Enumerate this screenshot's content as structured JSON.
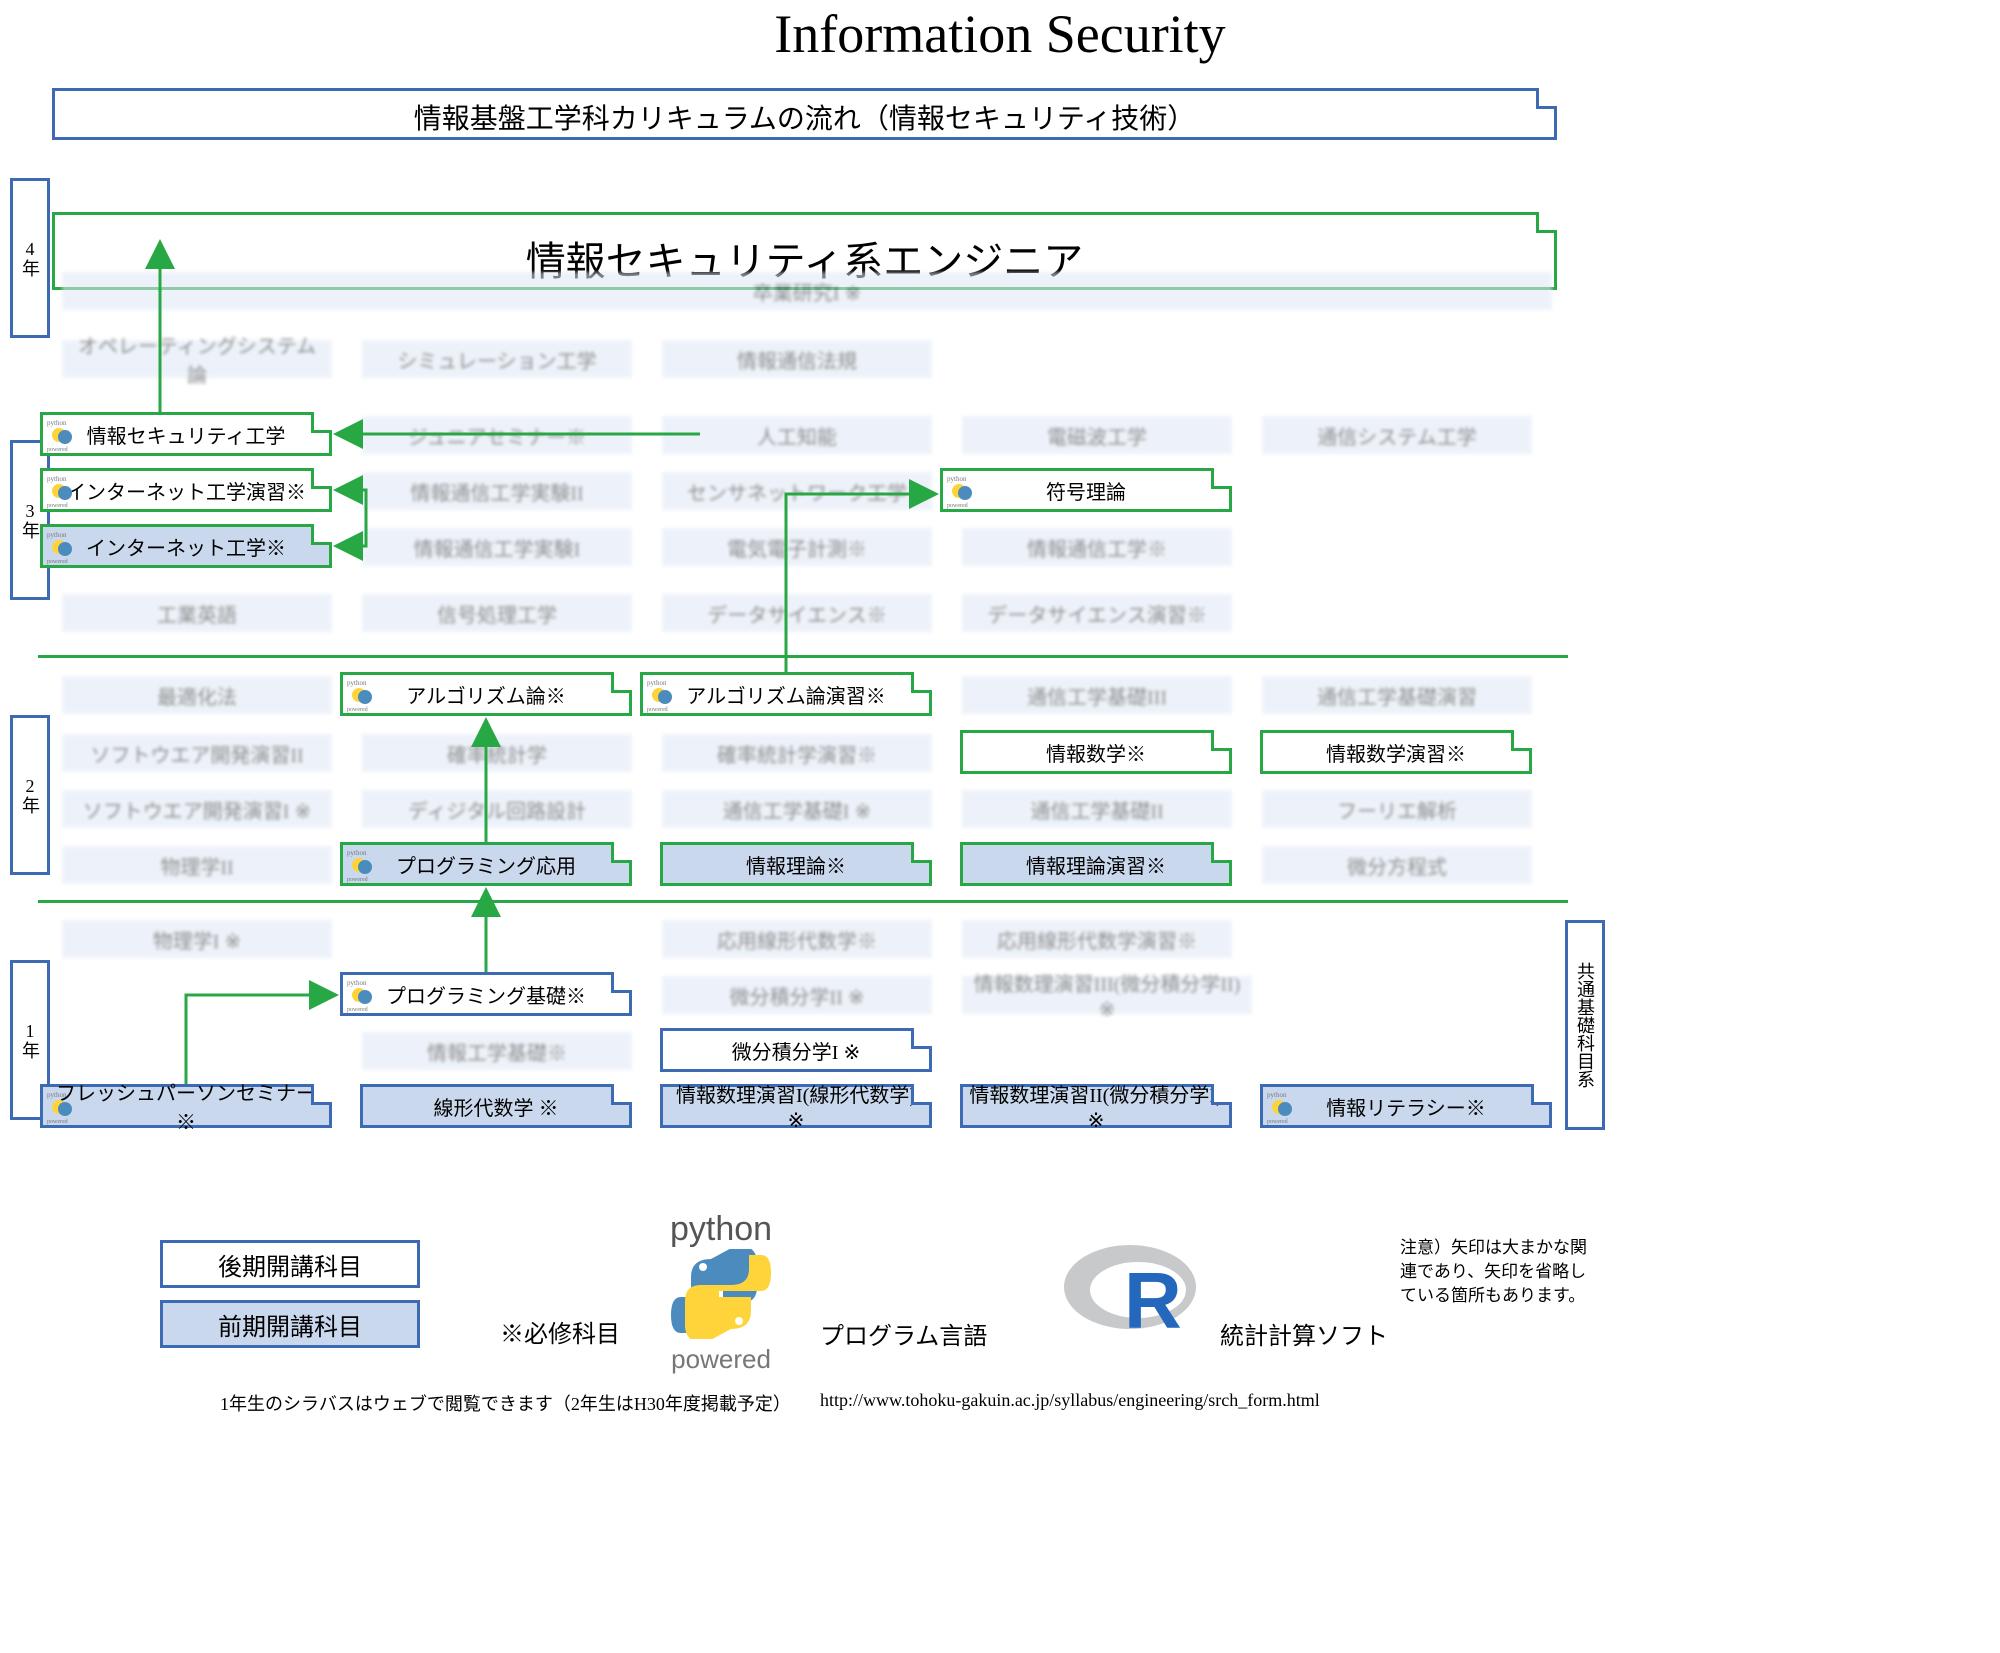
{
  "title": "Information Security",
  "subtitle": "情報基盤工学科カリキュラムの流れ（情報セキュリティ技術）",
  "career": "情報セキュリティ系エンジニア",
  "years": {
    "y1": "1年",
    "y2": "2年",
    "y3": "3年",
    "y4": "4年"
  },
  "right_tab": "共通基礎科目系",
  "legend": {
    "late": "後期開講科目",
    "early": "前期開講科目",
    "required": "※必修科目",
    "prog_lang": "プログラム言語",
    "stats_soft": "統計計算ソフト"
  },
  "note": "注意）矢印は大まかな関連であり、矢印を省略している箇所もあります。",
  "footer": {
    "syllabus": "1年生のシラバスはウェブで閲覧できます（2年生はH30年度掲載予定）",
    "url": "http://www.tohoku-gakuin.ac.jp/syllabus/engineering/srch_form.html"
  },
  "boxes": {
    "grad": "卒業研究I ※",
    "os": "オペレーティングシステム論",
    "sim": "シミュレーション工学",
    "infolaw": "情報通信法規",
    "jsec": "情報セキュリティ工学",
    "jrsem": "ジュニアセミナー※",
    "ai": "人工知能",
    "em": "電磁波工学",
    "comsys": "通信システム工学",
    "netpr": "インターネット工学演習※",
    "infoexp2": "情報通信工学実験II",
    "sensor": "センサネットワーク工学",
    "code": "符号理論",
    "net": "インターネット工学※",
    "infoexp1": "情報通信工学実験I",
    "elec": "電気電子計測※",
    "infocom": "情報通信工学※",
    "ieng": "工業英語",
    "sigproc": "信号処理工学",
    "ds": "データサイエンス※",
    "dspr": "データサイエンス演習※",
    "opt": "最適化法",
    "algo": "アルゴリズム論※",
    "algopr": "アルゴリズム論演習※",
    "com3": "通信工学基礎III",
    "compr": "通信工学基礎演習",
    "sw2": "ソフトウエア開発演習II",
    "prob": "確率統計学",
    "probpr": "確率統計学演習※",
    "infomath": "情報数学※",
    "infomathpr": "情報数学演習※",
    "sw1": "ソフトウエア開発演習I ※",
    "digi": "ディジタル回路設計",
    "com1": "通信工学基礎I ※",
    "com2": "通信工学基礎II",
    "fourier": "フーリエ解析",
    "phys2": "物理学II",
    "progadv": "プログラミング応用",
    "infoth": "情報理論※",
    "infothpr": "情報理論演習※",
    "diffeq": "微分方程式",
    "phys1": "物理学I ※",
    "linadv": "応用線形代数学※",
    "linadvpr": "応用線形代数学演習※",
    "progbas": "プログラミング基礎※",
    "calc2": "微分積分学II ※",
    "mathpr3": "情報数理演習III(微分積分学II) ※",
    "infoeng": "情報工学基礎※",
    "calc1": "微分積分学I ※",
    "fresh": "フレッシュパーソンセミナー ※",
    "lin": "線形代数学 ※",
    "mathpr1": "情報数理演習I(線形代数学) ※",
    "mathpr2": "情報数理演習II(微分積分学I) ※",
    "infolit": "情報リテラシー※"
  },
  "python_label": {
    "top": "python",
    "bottom": "powered"
  }
}
